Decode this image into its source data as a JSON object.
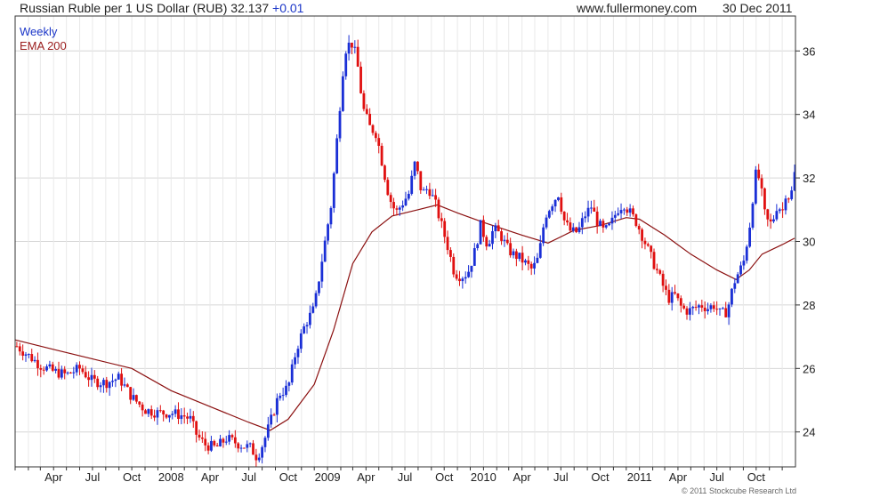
{
  "header": {
    "title": "Russian Ruble per 1 US Dollar (RUB) 32.137",
    "change": "+0.01",
    "site": "www.fullermoney.com",
    "date": "30 Dec 2011"
  },
  "legend": {
    "weekly": "Weekly",
    "ema": "EMA 200"
  },
  "copyright": "© 2011 Stockcube Research Ltd",
  "colors": {
    "up": "#1a2fd6",
    "down": "#e01010",
    "ema": "#8b1010",
    "grid": "#d6d6d6",
    "axis": "#333333",
    "legend_weekly": "#1a35c8",
    "legend_ema": "#9a1c1c"
  },
  "chart_data": {
    "type": "candlestick",
    "interval": "Weekly",
    "ylim": [
      22.9,
      37.1
    ],
    "y_ticks": [
      24,
      26,
      28,
      30,
      32,
      34,
      36
    ],
    "x_tick_labels": [
      "Apr",
      "Jul",
      "Oct",
      "2008",
      "Apr",
      "Jul",
      "Oct",
      "2009",
      "Apr",
      "Jul",
      "Oct",
      "2010",
      "Apr",
      "Jul",
      "Oct",
      "2011",
      "Apr",
      "Jul",
      "Oct"
    ],
    "grid": true,
    "legend_position": "top-left",
    "price_series": {
      "name": "Weekly",
      "points": [
        [
          "2007-01-05",
          26.7
        ],
        [
          "2007-02-02",
          26.4
        ],
        [
          "2007-03-01",
          26.1
        ],
        [
          "2007-04-01",
          25.9
        ],
        [
          "2007-05-01",
          25.8
        ],
        [
          "2007-06-01",
          26.0
        ],
        [
          "2007-07-01",
          25.6
        ],
        [
          "2007-08-01",
          25.55
        ],
        [
          "2007-09-01",
          25.7
        ],
        [
          "2007-10-01",
          25.1
        ],
        [
          "2007-11-01",
          24.7
        ],
        [
          "2007-12-01",
          24.6
        ],
        [
          "2008-01-01",
          24.6
        ],
        [
          "2008-02-01",
          24.5
        ],
        [
          "2008-02-15",
          24.4
        ],
        [
          "2008-03-01",
          23.9
        ],
        [
          "2008-03-20",
          23.6
        ],
        [
          "2008-04-15",
          23.5
        ],
        [
          "2008-05-10",
          23.8
        ],
        [
          "2008-06-10",
          23.6
        ],
        [
          "2008-07-05",
          23.5
        ],
        [
          "2008-07-20",
          23.2
        ],
        [
          "2008-08-05",
          23.7
        ],
        [
          "2008-08-20",
          24.3
        ],
        [
          "2008-09-10",
          25.2
        ],
        [
          "2008-10-01",
          25.4
        ],
        [
          "2008-10-20",
          26.6
        ],
        [
          "2008-11-10",
          27.4
        ],
        [
          "2008-12-01",
          27.9
        ],
        [
          "2008-12-20",
          29.5
        ],
        [
          "2009-01-10",
          31.2
        ],
        [
          "2009-01-25",
          33.5
        ],
        [
          "2009-02-10",
          36.0
        ],
        [
          "2009-02-25",
          36.3
        ],
        [
          "2009-03-10",
          35.8
        ],
        [
          "2009-03-25",
          34.2
        ],
        [
          "2009-04-10",
          33.6
        ],
        [
          "2009-04-25",
          33.4
        ],
        [
          "2009-05-10",
          32.4
        ],
        [
          "2009-05-25",
          31.4
        ],
        [
          "2009-06-10",
          30.9
        ],
        [
          "2009-06-25",
          31.2
        ],
        [
          "2009-07-10",
          31.5
        ],
        [
          "2009-07-25",
          32.5
        ],
        [
          "2009-08-10",
          31.5
        ],
        [
          "2009-08-25",
          31.7
        ],
        [
          "2009-09-10",
          31.2
        ],
        [
          "2009-09-25",
          30.5
        ],
        [
          "2009-10-10",
          29.8
        ],
        [
          "2009-10-25",
          29.0
        ],
        [
          "2009-11-10",
          28.9
        ],
        [
          "2009-11-25",
          29.0
        ],
        [
          "2009-12-10",
          29.6
        ],
        [
          "2009-12-25",
          30.5
        ],
        [
          "2010-01-10",
          29.9
        ],
        [
          "2010-01-25",
          30.4
        ],
        [
          "2010-02-10",
          30.2
        ],
        [
          "2010-02-25",
          29.8
        ],
        [
          "2010-03-10",
          29.6
        ],
        [
          "2010-03-25",
          29.5
        ],
        [
          "2010-04-10",
          29.3
        ],
        [
          "2010-04-25",
          29.1
        ],
        [
          "2010-05-10",
          29.5
        ],
        [
          "2010-05-25",
          30.8
        ],
        [
          "2010-06-10",
          31.2
        ],
        [
          "2010-06-25",
          31.5
        ],
        [
          "2010-07-10",
          30.6
        ],
        [
          "2010-07-25",
          30.3
        ],
        [
          "2010-08-10",
          30.3
        ],
        [
          "2010-08-25",
          30.8
        ],
        [
          "2010-09-10",
          31.1
        ],
        [
          "2010-09-25",
          30.6
        ],
        [
          "2010-10-10",
          30.3
        ],
        [
          "2010-10-25",
          30.5
        ],
        [
          "2010-11-10",
          31.0
        ],
        [
          "2010-11-25",
          31.2
        ],
        [
          "2010-12-10",
          30.9
        ],
        [
          "2010-12-25",
          30.6
        ],
        [
          "2011-01-10",
          30.1
        ],
        [
          "2011-01-25",
          29.6
        ],
        [
          "2011-02-10",
          29.1
        ],
        [
          "2011-02-25",
          28.6
        ],
        [
          "2011-03-10",
          28.2
        ],
        [
          "2011-03-25",
          28.3
        ],
        [
          "2011-04-10",
          27.9
        ],
        [
          "2011-04-25",
          27.8
        ],
        [
          "2011-05-10",
          27.9
        ],
        [
          "2011-05-25",
          28.0
        ],
        [
          "2011-06-10",
          27.9
        ],
        [
          "2011-06-25",
          28.0
        ],
        [
          "2011-07-10",
          27.7
        ],
        [
          "2011-07-25",
          27.8
        ],
        [
          "2011-08-10",
          28.7
        ],
        [
          "2011-08-20",
          29.0
        ],
        [
          "2011-09-01",
          29.3
        ],
        [
          "2011-09-15",
          30.4
        ],
        [
          "2011-09-25",
          31.6
        ],
        [
          "2011-10-01",
          32.2
        ],
        [
          "2011-10-10",
          31.9
        ],
        [
          "2011-10-20",
          30.9
        ],
        [
          "2011-11-01",
          30.5
        ],
        [
          "2011-11-10",
          30.7
        ],
        [
          "2011-11-20",
          31.2
        ],
        [
          "2011-12-01",
          30.9
        ],
        [
          "2011-12-10",
          31.6
        ],
        [
          "2011-12-20",
          31.3
        ],
        [
          "2011-12-30",
          32.137
        ]
      ]
    },
    "ema_series": {
      "name": "EMA 200",
      "points": [
        [
          "2007-01-01",
          26.9
        ],
        [
          "2007-04-01",
          26.6
        ],
        [
          "2007-07-01",
          26.3
        ],
        [
          "2007-10-01",
          26.0
        ],
        [
          "2008-01-01",
          25.3
        ],
        [
          "2008-04-01",
          24.8
        ],
        [
          "2008-07-01",
          24.3
        ],
        [
          "2008-08-20",
          24.05
        ],
        [
          "2008-10-01",
          24.4
        ],
        [
          "2008-12-01",
          25.5
        ],
        [
          "2009-01-15",
          27.2
        ],
        [
          "2009-03-01",
          29.3
        ],
        [
          "2009-04-15",
          30.3
        ],
        [
          "2009-06-01",
          30.8
        ],
        [
          "2009-08-01",
          31.0
        ],
        [
          "2009-09-15",
          31.15
        ],
        [
          "2009-11-01",
          30.9
        ],
        [
          "2010-01-01",
          30.6
        ],
        [
          "2010-04-01",
          30.2
        ],
        [
          "2010-06-01",
          29.95
        ],
        [
          "2010-08-01",
          30.35
        ],
        [
          "2010-10-01",
          30.5
        ],
        [
          "2010-12-01",
          30.75
        ],
        [
          "2011-01-01",
          30.7
        ],
        [
          "2011-03-01",
          30.2
        ],
        [
          "2011-05-01",
          29.6
        ],
        [
          "2011-07-01",
          29.1
        ],
        [
          "2011-08-15",
          28.8
        ],
        [
          "2011-09-15",
          29.1
        ],
        [
          "2011-10-15",
          29.6
        ],
        [
          "2011-12-01",
          29.9
        ],
        [
          "2011-12-30",
          30.1
        ]
      ]
    }
  }
}
